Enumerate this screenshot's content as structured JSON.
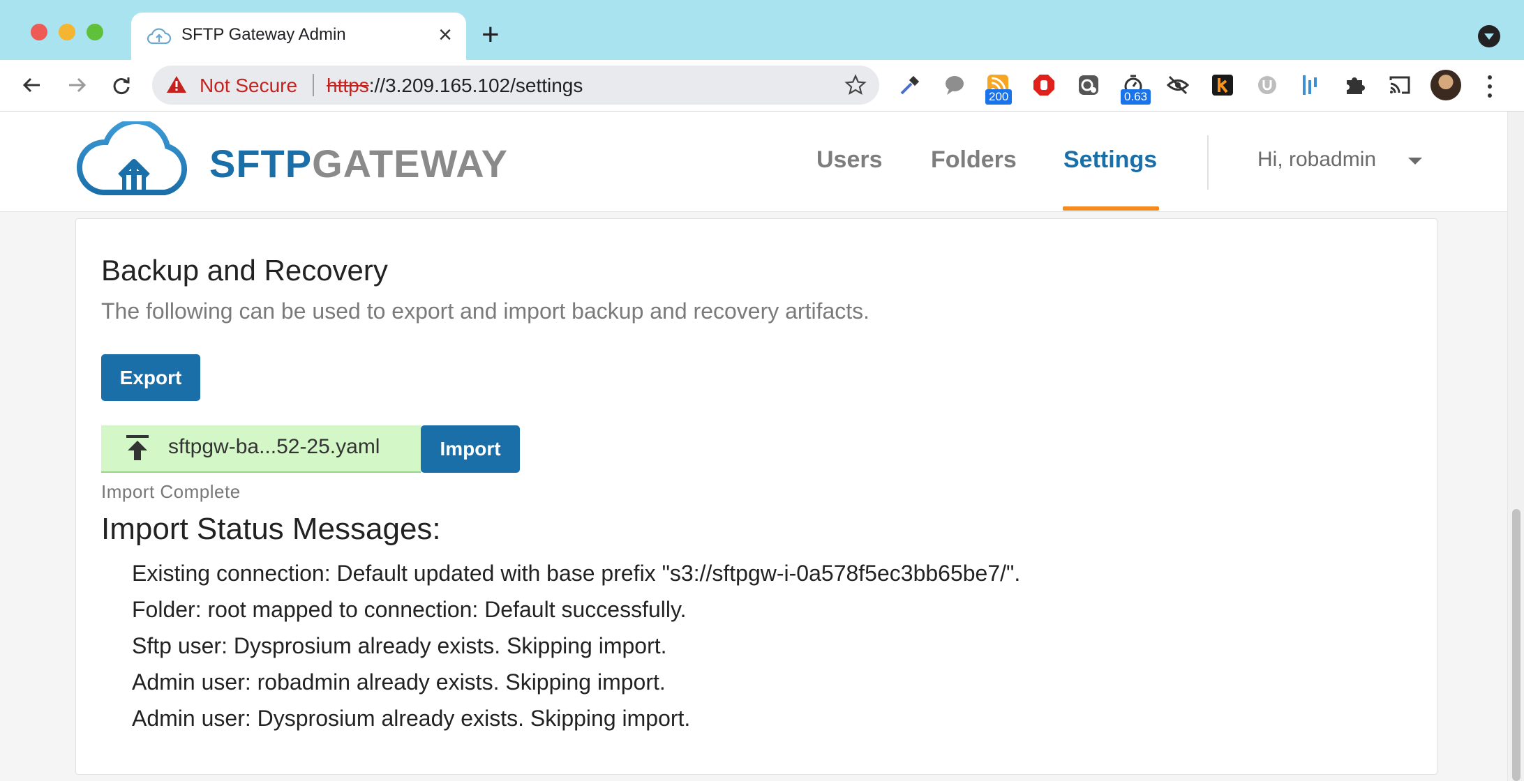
{
  "browser": {
    "tab_title": "SFTP Gateway Admin",
    "new_tab_label": "+",
    "security_label": "Not Secure",
    "url_scheme": "https",
    "url_rest": "://3.209.165.102/settings",
    "extensions": [
      {
        "name": "eyedropper-icon"
      },
      {
        "name": "speech-bubble-icon"
      },
      {
        "name": "rss-icon",
        "badge": "200"
      },
      {
        "name": "adblock-icon"
      },
      {
        "name": "grammar-icon"
      },
      {
        "name": "timer-icon",
        "badge": "0.63"
      },
      {
        "name": "eye-slash-icon"
      },
      {
        "name": "k-icon"
      },
      {
        "name": "u-icon"
      },
      {
        "name": "bars-icon"
      },
      {
        "name": "puzzle-icon"
      },
      {
        "name": "cast-icon"
      }
    ]
  },
  "app": {
    "logo": {
      "part1": "SFTP",
      "part2": "GATEWAY"
    },
    "nav": {
      "users": "Users",
      "folders": "Folders",
      "settings": "Settings",
      "active": "Settings"
    },
    "user_menu": "Hi, robadmin",
    "accent": "#1b6fa9",
    "active_underline_color": "#f58a1f"
  },
  "backup": {
    "title": "Backup and Recovery",
    "description": "The following can be used to export and import backup and recovery artifacts.",
    "export_label": "Export",
    "file_name": "sftpgw-ba...52-25.yaml",
    "import_label": "Import",
    "import_status": "Import Complete",
    "messages_title": "Import Status Messages:",
    "messages": [
      "Existing connection: Default updated with base prefix \"s3://sftpgw-i-0a578f5ec3bb65be7/\".",
      "Folder: root mapped to connection: Default successfully.",
      "Sftp user: Dysprosium already exists. Skipping import.",
      "Admin user: robadmin already exists. Skipping import.",
      "Admin user: Dysprosium already exists. Skipping import."
    ]
  }
}
